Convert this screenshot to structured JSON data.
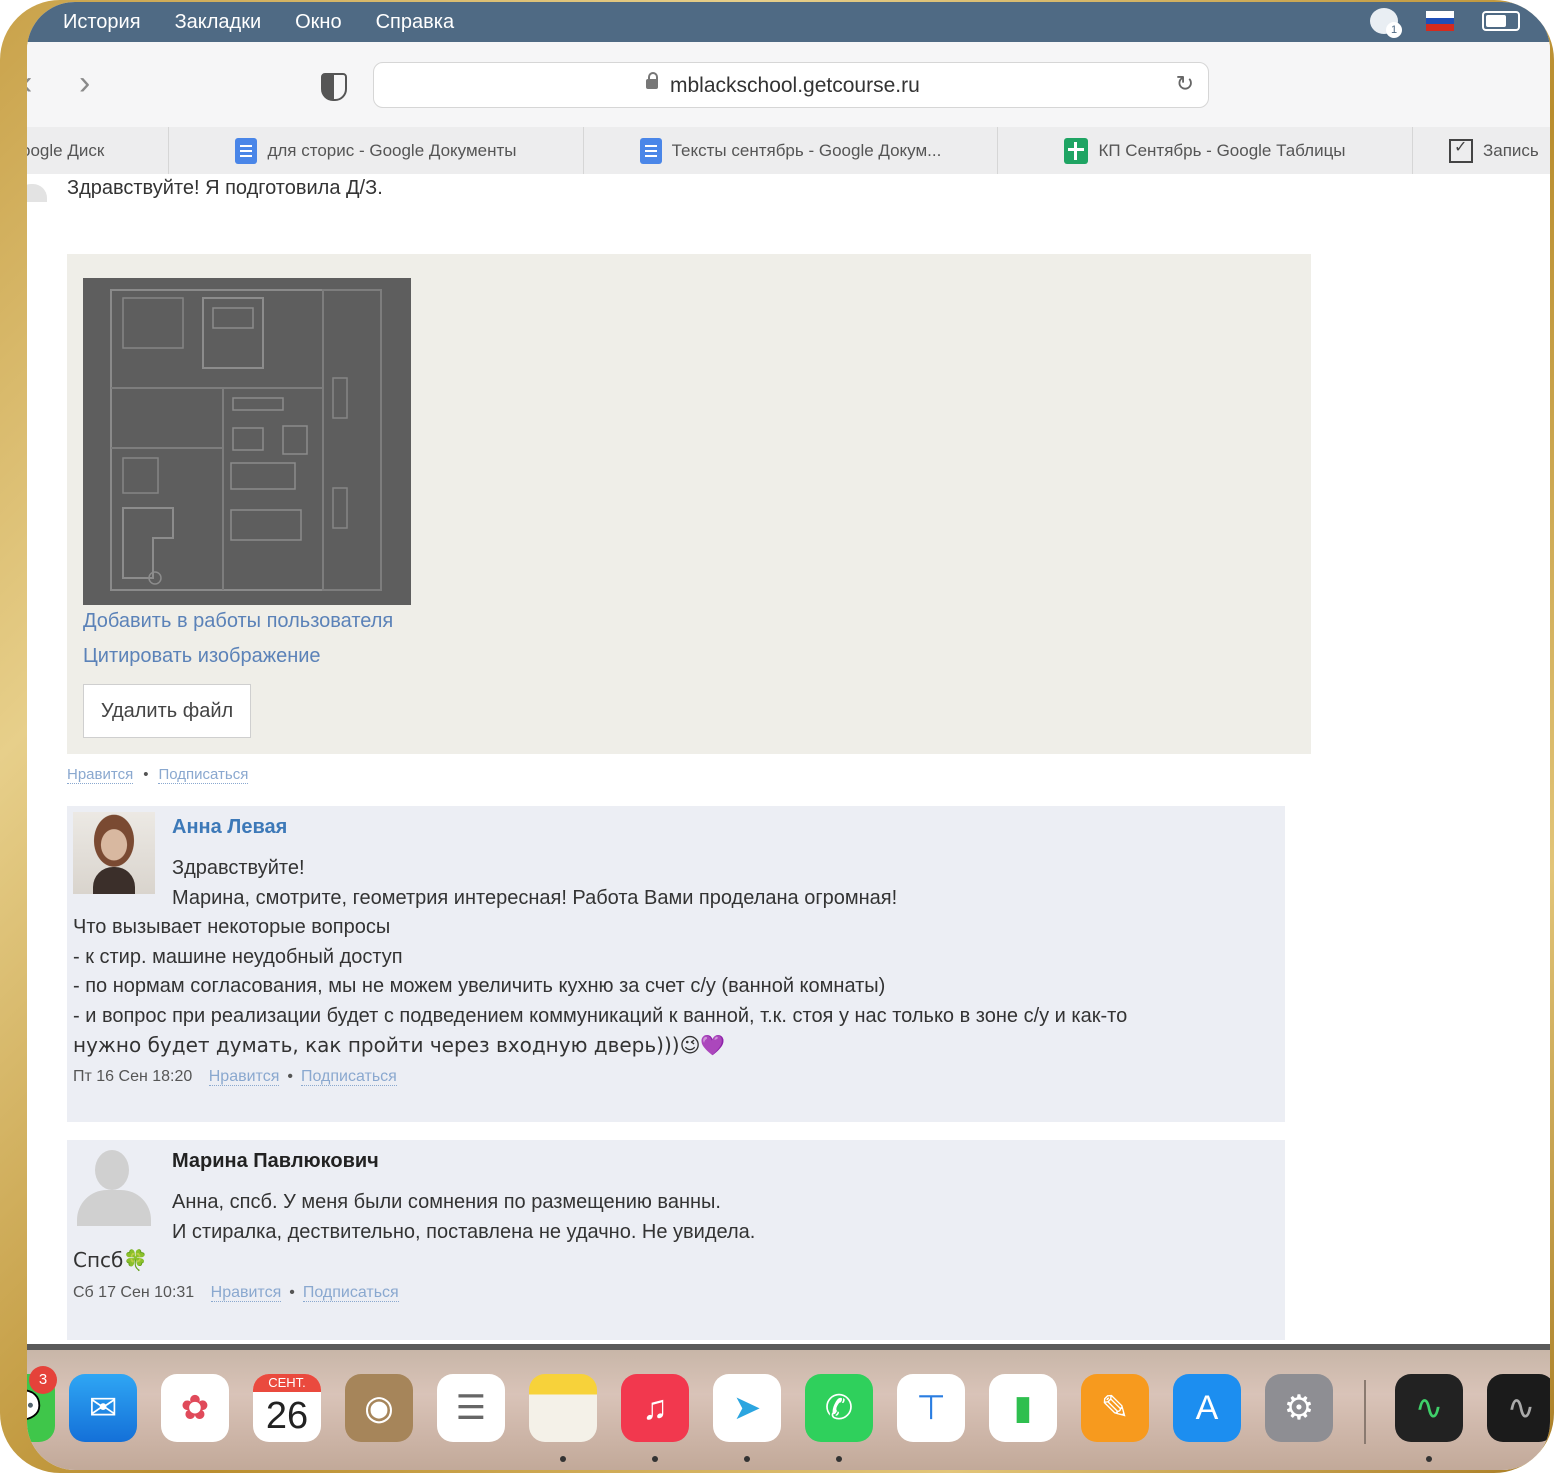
{
  "menubar": {
    "items": [
      "История",
      "Закладки",
      "Окно",
      "Справка"
    ],
    "notification_count": "1"
  },
  "toolbar": {
    "url": "mblackschool.getcourse.ru"
  },
  "bookmarks": [
    {
      "label": "oogle Диск",
      "icon": "google-drive-icon"
    },
    {
      "label": "для сторис - Google Документы",
      "icon": "google-docs-icon"
    },
    {
      "label": "Тексты сентябрь - Google Докум...",
      "icon": "google-docs-icon"
    },
    {
      "label": "КП Сентябрь - Google Таблицы",
      "icon": "google-sheets-icon"
    },
    {
      "label": "Запись",
      "icon": "mail-check-icon"
    }
  ],
  "post": {
    "greeting": "Здравствуйте! Я подготовила Д/З.",
    "attachment": {
      "add_link": "Добавить в работы пользователя",
      "quote_link": "Цитировать изображение",
      "delete_button": "Удалить файл"
    },
    "like": "Нравится",
    "subscribe": "Подписаться"
  },
  "comments": [
    {
      "author": "Анна Левая",
      "author_color": "#3d79b8",
      "lines_indented": [
        "Здравствуйте!",
        "Марина, смотрите, геометрия интересная! Работа Вами проделана огромная!"
      ],
      "lines_full": [
        "Что вызывает некоторые вопросы",
        "- к стир. машине неудобный доступ",
        "- по нормам согласования, мы не можем увеличить кухню за счет с/у (ванной комнаты)",
        "- и вопрос при реализации будет с подведением коммуникаций к ванной, т.к. стоя у нас только в зоне с/у и как-то",
        "нужно будет думать, как пройти через входную дверь)))😉💜"
      ],
      "date": "Пт 16 Сен 18:20",
      "like": "Нравится",
      "subscribe": "Подписаться"
    },
    {
      "author": "Марина Павлюкович",
      "author_color": "#222222",
      "lines_indented": [
        "Анна, спсб. У меня были сомнения по размещению ванны.",
        "И стиралка, дествительно, поставлена не удачно. Не увидела."
      ],
      "lines_full": [
        "Спсб🍀"
      ],
      "date": "Сб 17 Сен 10:31",
      "like": "Нравится",
      "subscribe": "Подписаться"
    }
  ],
  "dock": {
    "calendar_month": "СЕНТ.",
    "calendar_day": "26",
    "badge_count": "3",
    "apps": [
      "messages-icon",
      "mail-icon",
      "photos-icon",
      "calendar-icon",
      "contacts-icon",
      "reminders-icon",
      "notes-icon",
      "music-icon",
      "telegram-icon",
      "whatsapp-icon",
      "keynote-icon",
      "numbers-icon",
      "pages-icon",
      "app-store-icon",
      "system-preferences-icon",
      "activity-monitor-icon",
      "stocks-icon"
    ]
  },
  "colors": {
    "menubar": "#4f6a84",
    "link": "#5b82b8",
    "comment_bg": "#eceef4",
    "attachment_bg": "#efeee8"
  }
}
